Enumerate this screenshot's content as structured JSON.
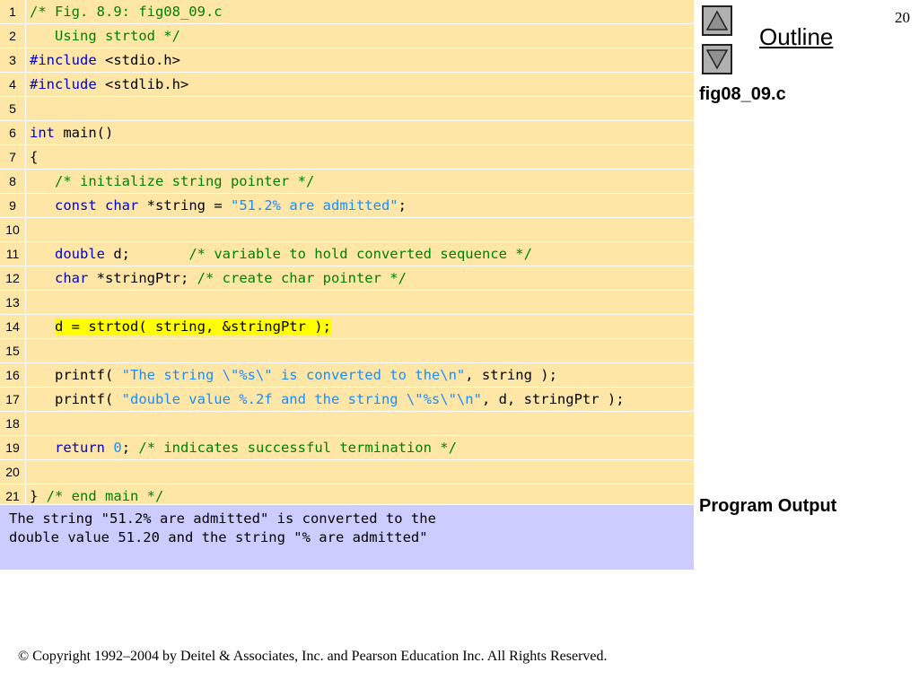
{
  "slide_number": "20",
  "outline_label": "Outline",
  "file_label": "fig08_09.c",
  "output_label": "Program Output",
  "footer": "© Copyright 1992–2004 by Deitel & Associates, Inc. and Pearson Education Inc. All Rights Reserved.",
  "icons": {
    "up": "triangle-up-icon",
    "down": "triangle-down-icon"
  },
  "colors": {
    "code_bg": "#fde6a6",
    "output_bg": "#ccccff",
    "keyword": "#0000cc",
    "comment": "#008000",
    "string": "#1a8cff",
    "highlight": "#ffff00"
  },
  "code_lines": [
    {
      "num": "1",
      "parts": [
        {
          "t": "/* Fig. 8.9: fig08_09.c",
          "c": "cm"
        }
      ]
    },
    {
      "num": "2",
      "parts": [
        {
          "t": "   Using strtod */",
          "c": "cm"
        }
      ]
    },
    {
      "num": "3",
      "parts": [
        {
          "t": "#include",
          "c": "kw"
        },
        {
          "t": " <stdio.h>",
          "c": ""
        }
      ]
    },
    {
      "num": "4",
      "parts": [
        {
          "t": "#include",
          "c": "kw"
        },
        {
          "t": " <stdlib.h>",
          "c": ""
        }
      ]
    },
    {
      "num": "5",
      "parts": []
    },
    {
      "num": "6",
      "parts": [
        {
          "t": "int",
          "c": "kw"
        },
        {
          "t": " main()",
          "c": ""
        }
      ]
    },
    {
      "num": "7",
      "parts": [
        {
          "t": "{",
          "c": ""
        }
      ]
    },
    {
      "num": "8",
      "parts": [
        {
          "t": "   ",
          "c": ""
        },
        {
          "t": "/* initialize string pointer */",
          "c": "cm"
        }
      ]
    },
    {
      "num": "9",
      "parts": [
        {
          "t": "   ",
          "c": ""
        },
        {
          "t": "const",
          "c": "kw"
        },
        {
          "t": " ",
          "c": ""
        },
        {
          "t": "char",
          "c": "kw"
        },
        {
          "t": " *string = ",
          "c": ""
        },
        {
          "t": "\"51.2% are admitted\"",
          "c": "st"
        },
        {
          "t": ";",
          "c": ""
        }
      ]
    },
    {
      "num": "10",
      "parts": []
    },
    {
      "num": "11",
      "parts": [
        {
          "t": "   ",
          "c": ""
        },
        {
          "t": "double",
          "c": "kw"
        },
        {
          "t": " d;       ",
          "c": ""
        },
        {
          "t": "/* variable to hold converted sequence */",
          "c": "cm"
        }
      ]
    },
    {
      "num": "12",
      "parts": [
        {
          "t": "   ",
          "c": ""
        },
        {
          "t": "char",
          "c": "kw"
        },
        {
          "t": " *stringPtr; ",
          "c": ""
        },
        {
          "t": "/* create char pointer */",
          "c": "cm"
        }
      ]
    },
    {
      "num": "13",
      "parts": []
    },
    {
      "num": "14",
      "parts": [
        {
          "t": "   ",
          "c": ""
        },
        {
          "t": "d = strtod( string, &stringPtr );",
          "c": "hl"
        }
      ]
    },
    {
      "num": "15",
      "parts": []
    },
    {
      "num": "16",
      "parts": [
        {
          "t": "   printf( ",
          "c": ""
        },
        {
          "t": "\"The string \\\"%s\\\" is converted to the\\n\"",
          "c": "st"
        },
        {
          "t": ", string );",
          "c": ""
        }
      ]
    },
    {
      "num": "17",
      "parts": [
        {
          "t": "   printf( ",
          "c": ""
        },
        {
          "t": "\"double value %.2f and the string \\\"%s\\\"\\n\"",
          "c": "st"
        },
        {
          "t": ", d, stringPtr );",
          "c": ""
        }
      ]
    },
    {
      "num": "18",
      "parts": []
    },
    {
      "num": "19",
      "parts": [
        {
          "t": "   ",
          "c": ""
        },
        {
          "t": "return",
          "c": "kw"
        },
        {
          "t": " ",
          "c": ""
        },
        {
          "t": "0",
          "c": "st"
        },
        {
          "t": "; ",
          "c": ""
        },
        {
          "t": "/* indicates successful termination */",
          "c": "cm"
        }
      ]
    },
    {
      "num": "20",
      "parts": []
    },
    {
      "num": "21",
      "parts": [
        {
          "t": "} ",
          "c": ""
        },
        {
          "t": "/* end main */",
          "c": "cm"
        }
      ]
    }
  ],
  "output_lines": [
    "The string \"51.2% are admitted\" is converted to the",
    "double value 51.20 and the string \"% are admitted\""
  ]
}
